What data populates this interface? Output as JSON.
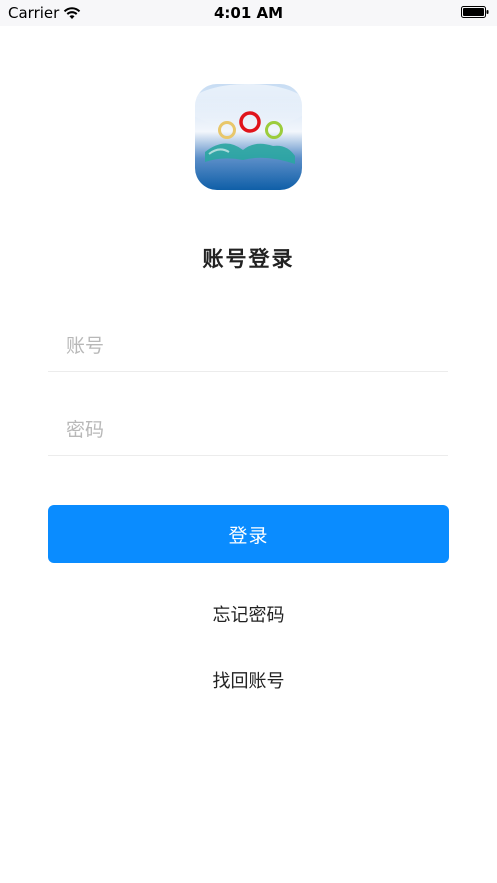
{
  "status_bar": {
    "carrier": "Carrier",
    "time": "4:01 AM",
    "icons": [
      "wifi-icon",
      "battery-icon"
    ]
  },
  "logo": {
    "icon": "app-logo-icon",
    "colors": {
      "bg_top": "#c7dcf3",
      "bg_bottom": "#0f5fa8",
      "ring_left": "#e8c76b",
      "ring_middle": "#e0141b",
      "ring_right": "#9ccc3c",
      "figures": "#2aa6a1"
    }
  },
  "title": "账号登录",
  "form": {
    "account_placeholder": "账号",
    "password_placeholder": "密码",
    "login_label": "登录"
  },
  "links": {
    "forgot_password": "忘记密码",
    "recover_account": "找回账号"
  },
  "colors": {
    "primary": "#0a8cff",
    "divider": "#ececec",
    "placeholder": "#b8b8b8"
  }
}
